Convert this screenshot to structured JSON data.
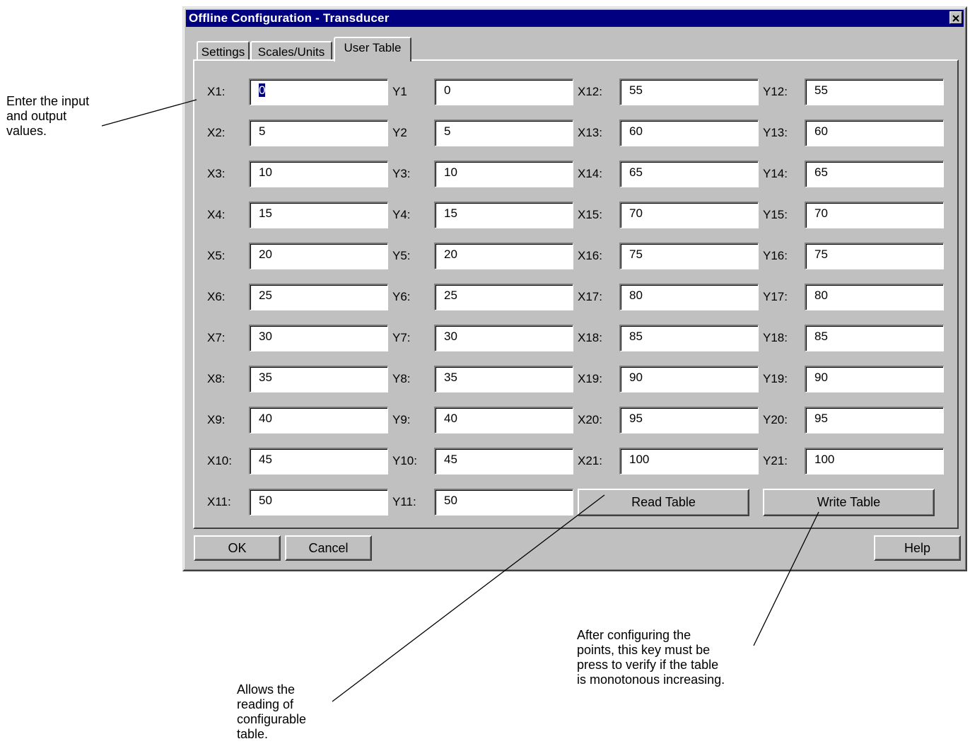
{
  "window": {
    "title": "Offline Configuration - Transducer",
    "close_icon": "close-icon"
  },
  "tabs": [
    {
      "label": "Settings",
      "active": false
    },
    {
      "label": "Scales/Units",
      "active": false
    },
    {
      "label": "User Table",
      "active": true
    }
  ],
  "table": {
    "col1": [
      {
        "label": "X1:",
        "value": "0",
        "selected": true
      },
      {
        "label": "X2:",
        "value": "5"
      },
      {
        "label": "X3:",
        "value": "10"
      },
      {
        "label": "X4:",
        "value": "15"
      },
      {
        "label": "X5:",
        "value": "20"
      },
      {
        "label": "X6:",
        "value": "25"
      },
      {
        "label": "X7:",
        "value": "30"
      },
      {
        "label": "X8:",
        "value": "35"
      },
      {
        "label": "X9:",
        "value": "40"
      },
      {
        "label": "X10:",
        "value": "45"
      },
      {
        "label": "X11:",
        "value": "50"
      }
    ],
    "col2": [
      {
        "label": "Y1",
        "value": "0"
      },
      {
        "label": "Y2",
        "value": "5"
      },
      {
        "label": "Y3:",
        "value": "10"
      },
      {
        "label": "Y4:",
        "value": "15"
      },
      {
        "label": "Y5:",
        "value": "20"
      },
      {
        "label": "Y6:",
        "value": "25"
      },
      {
        "label": "Y7:",
        "value": "30"
      },
      {
        "label": "Y8:",
        "value": "35"
      },
      {
        "label": "Y9:",
        "value": "40"
      },
      {
        "label": "Y10:",
        "value": "45"
      },
      {
        "label": "Y11:",
        "value": "50"
      }
    ],
    "col3": [
      {
        "label": "X12:",
        "value": "55"
      },
      {
        "label": "X13:",
        "value": "60"
      },
      {
        "label": "X14:",
        "value": "65"
      },
      {
        "label": "X15:",
        "value": "70"
      },
      {
        "label": "X16:",
        "value": "75"
      },
      {
        "label": "X17:",
        "value": "80"
      },
      {
        "label": "X18:",
        "value": "85"
      },
      {
        "label": "X19:",
        "value": "90"
      },
      {
        "label": "X20:",
        "value": "95"
      },
      {
        "label": "X21:",
        "value": "100"
      }
    ],
    "col4": [
      {
        "label": "Y12:",
        "value": "55"
      },
      {
        "label": "Y13:",
        "value": "60"
      },
      {
        "label": "Y14:",
        "value": "65"
      },
      {
        "label": "Y15:",
        "value": "70"
      },
      {
        "label": "Y16:",
        "value": "75"
      },
      {
        "label": "Y17:",
        "value": "80"
      },
      {
        "label": "Y18:",
        "value": "85"
      },
      {
        "label": "Y19:",
        "value": "90"
      },
      {
        "label": "Y20:",
        "value": "95"
      },
      {
        "label": "Y21:",
        "value": "100"
      }
    ],
    "read_table_label": "Read Table",
    "write_table_label": "Write Table"
  },
  "footer": {
    "ok_label": "OK",
    "cancel_label": "Cancel",
    "help_label": "Help"
  },
  "callouts": {
    "input_output": "Enter the input\nand output\nvalues.",
    "read_table": "Allows the\nreading of\nconfigurable\ntable.",
    "write_table": "After configuring the\npoints, this key must be\npress to verify if the table\nis monotonous increasing."
  }
}
